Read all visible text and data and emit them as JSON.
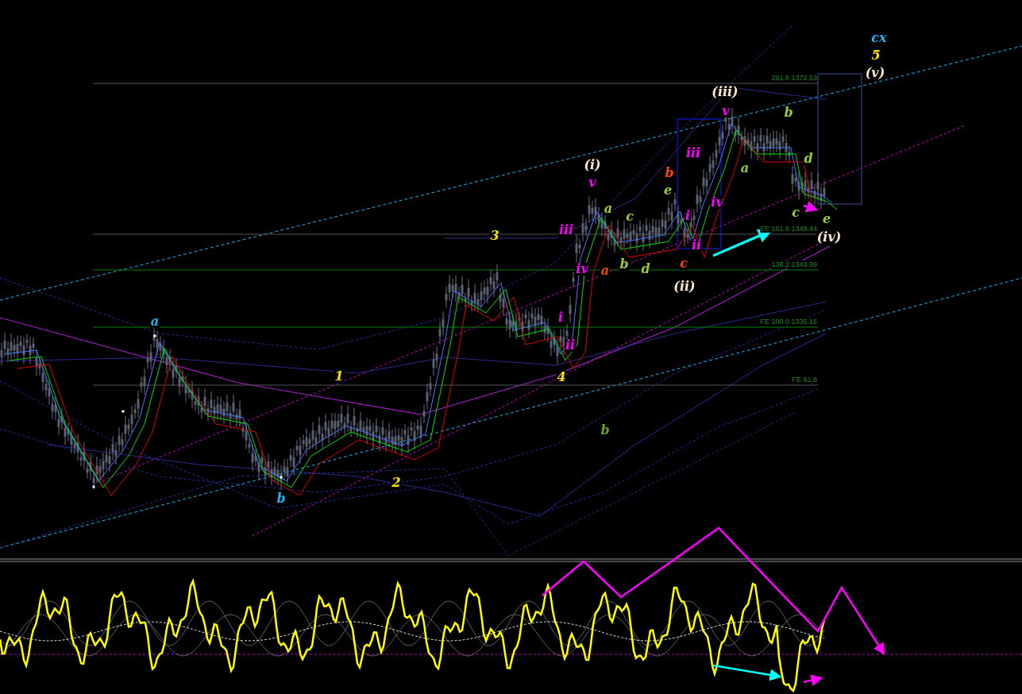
{
  "main_chart": {
    "fib_levels": [
      {
        "label": "261.8 1372.53",
        "kind": "minor"
      },
      {
        "label": "FE 161.8 1349.44",
        "kind": "minor"
      },
      {
        "label": "138.2 1343.99",
        "kind": "major"
      },
      {
        "label": "FE 100.0 1335.16",
        "kind": "major"
      },
      {
        "label": "FE 61.8",
        "kind": "minor"
      }
    ],
    "wave_labels": [
      {
        "text": "cx",
        "color": "#1eb4f0"
      },
      {
        "text": "5",
        "color": "#ffe600"
      },
      {
        "text": "(v)",
        "color": "#ffe9cc"
      },
      {
        "text": "(iii)",
        "color": "#ffe9cc"
      },
      {
        "text": "b",
        "color": "#9acd32"
      },
      {
        "text": "v",
        "color": "#ff00ff"
      },
      {
        "text": "iii",
        "color": "#ff00ff"
      },
      {
        "text": "a",
        "color": "#9acd32"
      },
      {
        "text": "d",
        "color": "#9acd32"
      },
      {
        "text": "(i)",
        "color": "#ffe9cc"
      },
      {
        "text": "v",
        "color": "#ff00ff"
      },
      {
        "text": "b",
        "color": "#ff4500"
      },
      {
        "text": "e",
        "color": "#9acd32"
      },
      {
        "text": "a",
        "color": "#9acd32"
      },
      {
        "text": "c",
        "color": "#9acd32"
      },
      {
        "text": "i",
        "color": "#ff00ff"
      },
      {
        "text": "iv",
        "color": "#ff00ff"
      },
      {
        "text": "c",
        "color": "#9acd32"
      },
      {
        "text": "e",
        "color": "#9acd32"
      },
      {
        "text": "iii",
        "color": "#ff00ff"
      },
      {
        "text": "3",
        "color": "#ffe600"
      },
      {
        "text": "ii",
        "color": "#ff00ff"
      },
      {
        "text": "(iv)",
        "color": "#ffe9cc"
      },
      {
        "text": "iv",
        "color": "#ff00ff"
      },
      {
        "text": "a",
        "color": "#ff4500"
      },
      {
        "text": "b",
        "color": "#9acd32"
      },
      {
        "text": "d",
        "color": "#9acd32"
      },
      {
        "text": "c",
        "color": "#ff4500"
      },
      {
        "text": "(ii)",
        "color": "#ffe9cc"
      },
      {
        "text": "a",
        "color": "#1eb4f0"
      },
      {
        "text": "i",
        "color": "#ff00ff"
      },
      {
        "text": "ii",
        "color": "#ff00ff"
      },
      {
        "text": "1",
        "color": "#ffe600"
      },
      {
        "text": "4",
        "color": "#ffe600"
      },
      {
        "text": "b",
        "color": "#6b9e23"
      },
      {
        "text": "2",
        "color": "#ffe600"
      },
      {
        "text": "b",
        "color": "#1eb4f0"
      }
    ]
  }
}
